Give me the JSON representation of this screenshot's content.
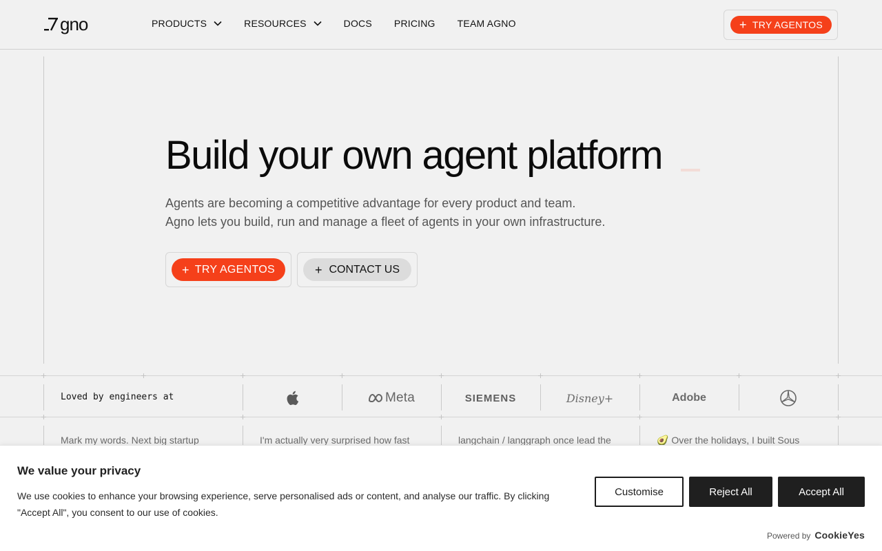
{
  "header": {
    "logo_text": "gno",
    "nav": [
      {
        "label": "PRODUCTS",
        "has_dropdown": true
      },
      {
        "label": "RESOURCES",
        "has_dropdown": true
      },
      {
        "label": "DOCS",
        "has_dropdown": false
      },
      {
        "label": "PRICING",
        "has_dropdown": false
      },
      {
        "label": "TEAM AGNO",
        "has_dropdown": false
      }
    ],
    "cta_label": "TRY AGENTOS"
  },
  "hero": {
    "title": "Build your own agent platform",
    "subtitle_line1": "Agents are becoming a competitive advantage for every product and team.",
    "subtitle_line2": "Agno lets you build, run and manage a fleet of agents in your own infrastructure.",
    "primary_button": "TRY AGENTOS",
    "secondary_button": "CONTACT US"
  },
  "logos": {
    "intro": "Loved by engineers at",
    "brands": {
      "apple": "apple-icon",
      "meta": "Meta",
      "siemens": "SIEMENS",
      "disney": "Disney+",
      "adobe": "Adobe",
      "mercedes": "mercedes-icon"
    }
  },
  "quotes": [
    "Mark my words. Next big startup",
    "I'm actually very surprised how fast",
    "langchain / langgraph once lead the",
    "🥑 Over the holidays, I built Sous"
  ],
  "cookie": {
    "title": "We value your privacy",
    "text": "We use cookies to enhance your browsing experience, serve personalised ads or content, and analyse our traffic. By clicking \"Accept All\", you consent to our use of cookies.",
    "customise": "Customise",
    "reject": "Reject All",
    "accept": "Accept All",
    "powered_label": "Powered by",
    "powered_brand": "CookieYes"
  },
  "colors": {
    "accent": "#f5401a",
    "background": "#f1f1f1",
    "dark_button": "#1f1f1f"
  }
}
